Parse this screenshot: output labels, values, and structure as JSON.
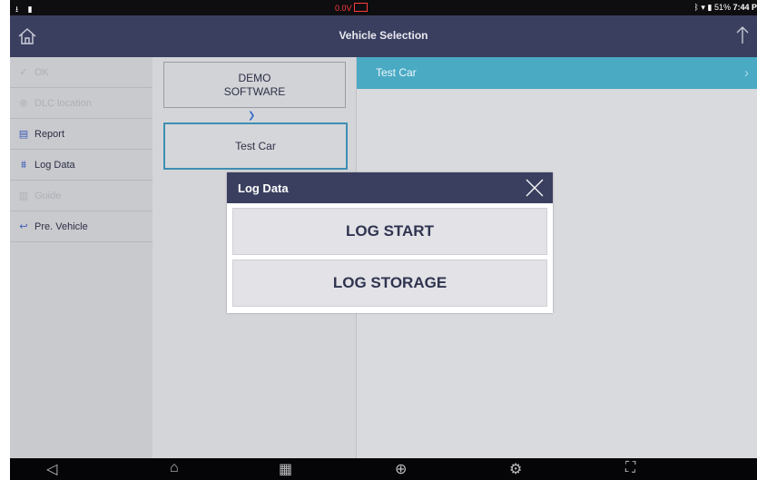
{
  "status": {
    "voltage": "0.0V",
    "battery_percent": "51%",
    "time": "7:44 P"
  },
  "title": "Vehicle Selection",
  "sidebar": {
    "items": [
      {
        "label": "OK",
        "enabled": false,
        "icon": "check-icon"
      },
      {
        "label": "DLC location",
        "enabled": false,
        "icon": "connector-icon"
      },
      {
        "label": "Report",
        "enabled": true,
        "icon": "report-icon"
      },
      {
        "label": "Log Data",
        "enabled": true,
        "icon": "log-data-icon"
      },
      {
        "label": "Guide",
        "enabled": false,
        "icon": "guide-icon"
      },
      {
        "label": "Pre. Vehicle",
        "enabled": true,
        "icon": "back-arrow-icon"
      }
    ]
  },
  "middle": {
    "demo_line1": "DEMO",
    "demo_line2": "SOFTWARE",
    "selected": "Test Car"
  },
  "right": {
    "selected_row": "Test Car"
  },
  "dialog": {
    "title": "Log Data",
    "buttons": [
      "LOG START",
      "LOG STORAGE"
    ]
  },
  "colors": {
    "header": "#3a3f5f",
    "accent": "#4aaac4",
    "selected_border": "#3e8fb3"
  }
}
